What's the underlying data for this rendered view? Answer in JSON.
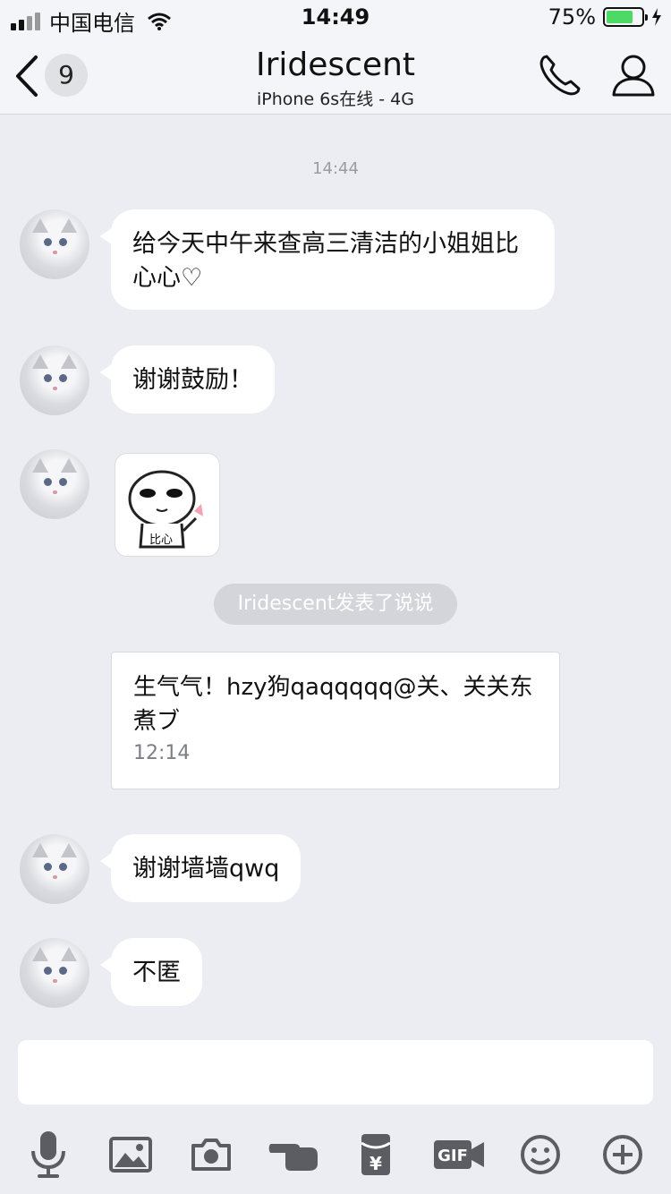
{
  "status_bar": {
    "carrier": "中国电信",
    "time": "14:49",
    "battery_percent": "75%",
    "battery_level": 0.75,
    "icons": [
      "signal-icon",
      "wifi-icon",
      "battery-icon",
      "charging-bolt-icon"
    ]
  },
  "nav": {
    "unread_count": "9",
    "title": "Iridescent",
    "subtitle": "iPhone 6s在线 - 4G",
    "icons": [
      "back-chevron-icon",
      "phone-call-icon",
      "profile-icon"
    ]
  },
  "chat": {
    "timestamp": "14:44",
    "messages": [
      {
        "text": "给今天中午来查高三清洁的小姐姐比心心♡"
      },
      {
        "text": "谢谢鼓励！"
      },
      {
        "sticker_text": "比心"
      },
      {
        "notice": "Iridescent发表了说说"
      },
      {
        "card_text": "生气气！hzy狗qaqqqqq@关、关关东煮ブ",
        "card_time": "12:14"
      },
      {
        "text": "谢谢墙墙qwq"
      },
      {
        "text": "不匿"
      }
    ]
  },
  "input": {
    "placeholder": ""
  },
  "toolbar": {
    "icons": [
      "microphone-icon",
      "image-icon",
      "camera-icon",
      "poke-hand-icon",
      "red-packet-icon",
      "gif-icon",
      "emoji-icon",
      "plus-icon"
    ],
    "gif_label": "GIF",
    "red_packet_symbol": "¥"
  },
  "colors": {
    "background": "#ebedf2",
    "bubble": "#ffffff",
    "battery_green": "#4cd964",
    "icon_gray": "#5b5d63"
  }
}
